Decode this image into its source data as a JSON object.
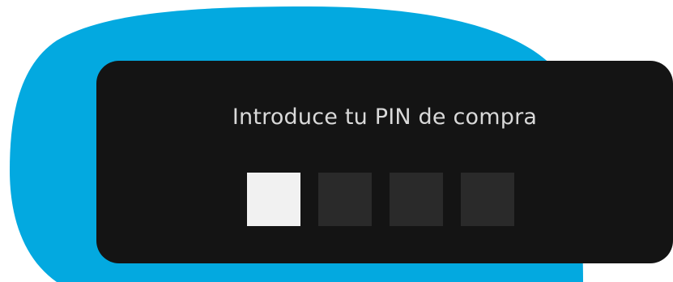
{
  "dialog": {
    "title": "Introduce tu PIN de compra"
  },
  "pin": {
    "length": 4,
    "filled": 0,
    "focused_index": 0
  },
  "colors": {
    "accent_blob": "#03a9e0",
    "dialog_bg": "#141414",
    "title_text": "#d9d9d9",
    "pin_box_empty": "#2a2a2a",
    "pin_box_focused": "#f1f1f1"
  }
}
